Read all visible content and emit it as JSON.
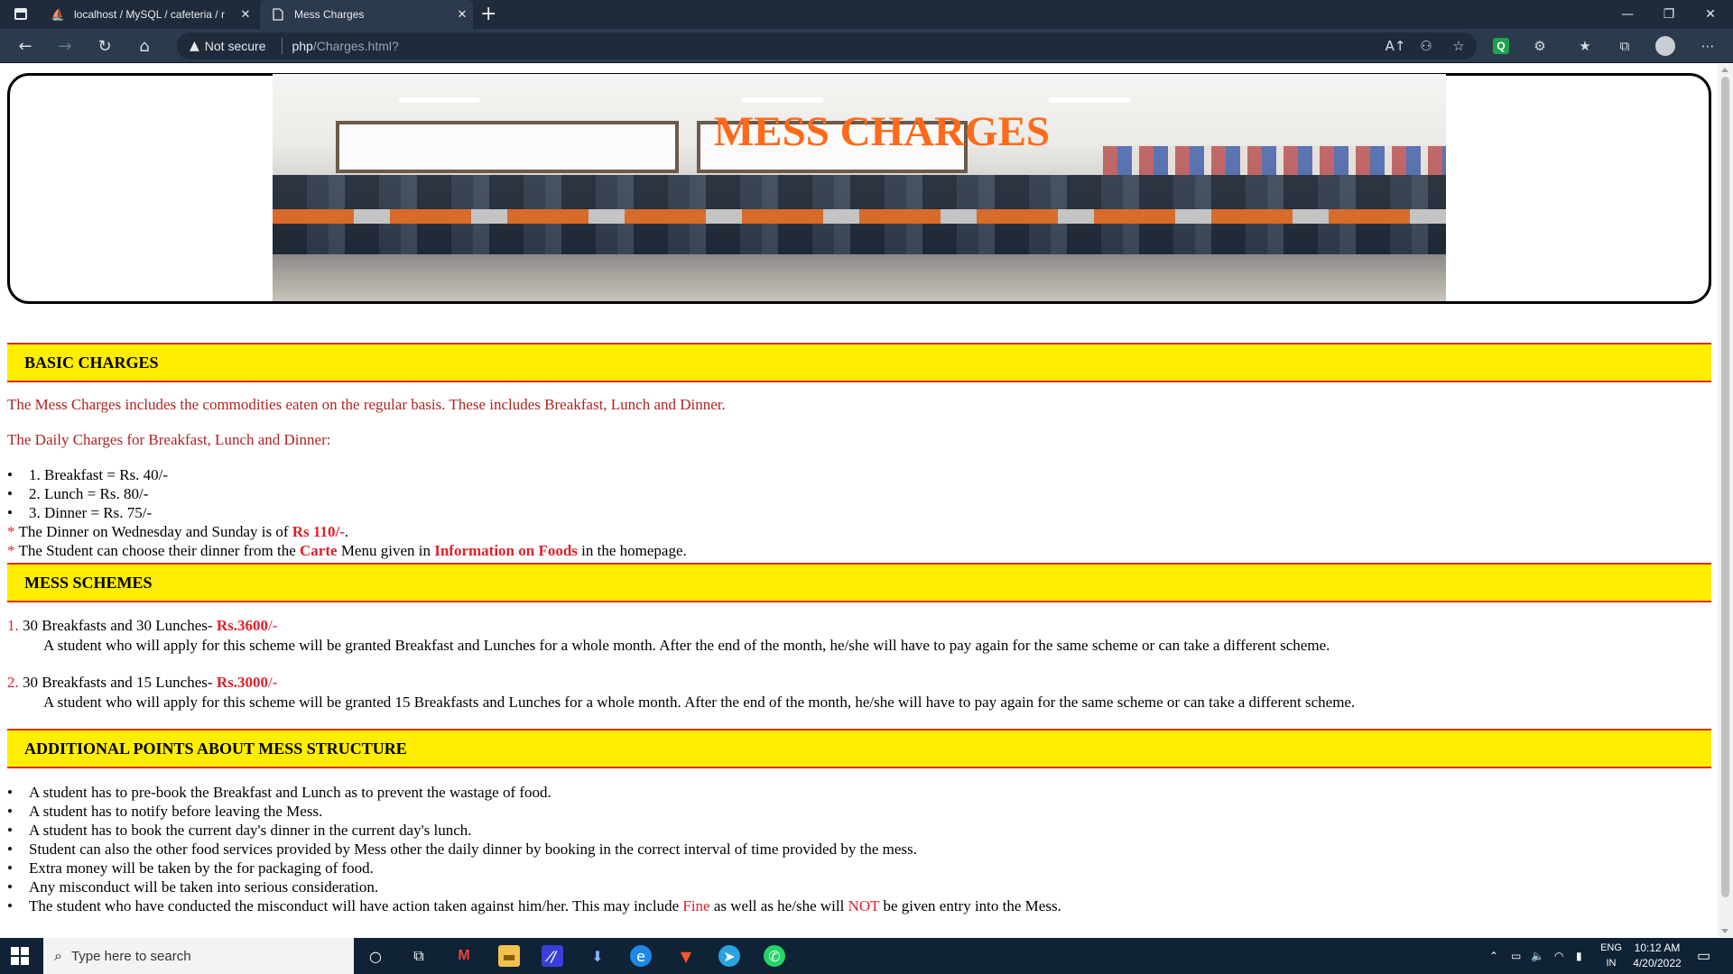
{
  "browser": {
    "tabs": [
      {
        "title": "localhost / MySQL / cafeteria / r",
        "favicon": "phpmyadmin-icon",
        "active": false
      },
      {
        "title": "Mess Charges",
        "favicon": "page-icon",
        "active": true
      }
    ],
    "security_label": "Not secure",
    "url_host": "php",
    "url_path": "/Charges.html?"
  },
  "page": {
    "banner_title": "MESS CHARGES",
    "sections": {
      "basic": {
        "heading": "BASIC CHARGES",
        "intro": "The Mess Charges includes the commodities eaten on the regular basis. These includes Breakfast, Lunch and Dinner.",
        "daily_label": "The Daily Charges for Breakfast, Lunch and Dinner:",
        "items": [
          "1. Breakfast = Rs. 40/-",
          "2. Lunch = Rs. 80/-",
          "3. Dinner = Rs. 75/-"
        ],
        "note1_pre": "The Dinner on Wednesday and Sunday is of ",
        "note1_price": "Rs 110/-",
        "note1_post": ".",
        "note2_a": "The Student can choose their dinner from the ",
        "note2_carte": "Carte",
        "note2_b": " Menu given in ",
        "note2_info": "Information on Foods",
        "note2_c": " in the homepage."
      },
      "schemes": {
        "heading": "MESS SCHEMES",
        "list": [
          {
            "num": "1.",
            "title": "30 Breakfasts and 30 Lunches- ",
            "price": "Rs.3600",
            "suffix": "/-",
            "desc": "A student who will apply for this scheme will be granted Breakfast and Lunches for a whole month. After the end of the month, he/she will have to pay again for the same scheme or can take a different scheme."
          },
          {
            "num": "2.",
            "title": "30 Breakfasts and 15 Lunches- ",
            "price": "Rs.3000",
            "suffix": "/-",
            "desc": "A student who will apply for this scheme will be granted 15 Breakfasts and Lunches for a whole month. After the end of the month, he/she will have to pay again for the same scheme or can take a different scheme."
          }
        ]
      },
      "additional": {
        "heading": "ADDITIONAL POINTS ABOUT MESS STRUCTURE",
        "points": [
          "A student has to pre-book the Breakfast and Lunch as to prevent the wastage of food.",
          "A student has to notify before leaving the Mess.",
          "A student has to book the current day's dinner in the current day's lunch.",
          "Student can also the other food services provided by Mess other the daily dinner by booking in the correct interval of time provided by the mess.",
          "Extra money will be taken by the for packaging of food.",
          "Any misconduct will be taken into serious consideration."
        ],
        "last_a": "The student who have conducted the misconduct will have action taken against him/her. This may include ",
        "last_fine": "Fine",
        "last_b": " as well as he/she will ",
        "last_not": "NOT",
        "last_c": " be given entry into the Mess."
      }
    }
  },
  "taskbar": {
    "search_placeholder": "Type here to search",
    "lang_line1": "ENG",
    "lang_line2": "IN",
    "time": "10:12 AM",
    "date": "4/20/2022"
  },
  "colors": {
    "accent_title": "#ff6a1a",
    "section_bg": "#ffee00",
    "section_border": "#e0301a",
    "red_text": "#e0202a",
    "intro_text": "#b22222"
  }
}
